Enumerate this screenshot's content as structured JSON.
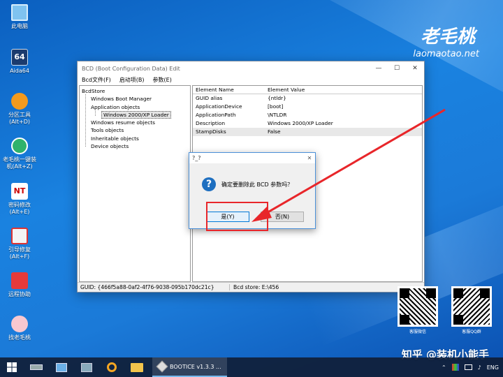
{
  "desktop": {
    "icons": [
      {
        "label": "此电脑",
        "icon": "computer-icon"
      },
      {
        "label": "Aida64",
        "icon": "aida64-icon",
        "badge": "64"
      },
      {
        "label": "分区工具\n(Alt+D)",
        "icon": "partition-tool-icon"
      },
      {
        "label": "老毛桃一键装\n机(Alt+Z)",
        "icon": "installer-icon"
      },
      {
        "label": "密码修改\n(Alt+E)",
        "icon": "password-tool-icon",
        "badge": "NT"
      },
      {
        "label": "引导修复\n(Alt+F)",
        "icon": "boot-repair-icon"
      },
      {
        "label": "远程协助",
        "icon": "remote-assist-icon"
      },
      {
        "label": "找老毛桃",
        "icon": "laomaotao-icon"
      }
    ]
  },
  "brand": {
    "logo": "老毛桃",
    "url": "laomaotao.net"
  },
  "window": {
    "title": "BCD (Boot Configuration Data) Edit",
    "menu": [
      "Bcd文件(F)",
      "启动项(B)",
      "参数(E)"
    ],
    "tree": [
      {
        "label": "BcdStore",
        "level": 0
      },
      {
        "label": "Windows Boot Manager",
        "level": 1
      },
      {
        "label": "Application objects",
        "level": 1
      },
      {
        "label": "Windows 2000/XP Loader",
        "level": 2
      },
      {
        "label": "Windows resume objects",
        "level": 1
      },
      {
        "label": "Tools objects",
        "level": 1
      },
      {
        "label": "Inheritable objects",
        "level": 1
      },
      {
        "label": "Device objects",
        "level": 1
      }
    ],
    "columns": [
      "Element Name",
      "Element Value"
    ],
    "rows": [
      [
        "GUID alias",
        "{ntldr}"
      ],
      [
        "ApplicationDevice",
        "[boot]"
      ],
      [
        "ApplicationPath",
        "\\NTLDR"
      ],
      [
        "Description",
        "Windows 2000/XP Loader"
      ],
      [
        "StampDisks",
        "False"
      ]
    ],
    "status": {
      "guid": "GUID:  {466f5a88-0af2-4f76-9038-095b170dc21c}",
      "store": "Bcd store:   E:\\456"
    }
  },
  "dialog": {
    "title": "?_?",
    "message": "确定要删除此 BCD 参数吗？",
    "yes_label": "是(Y)",
    "no_label": "否(N)"
  },
  "qr": [
    {
      "caption": "客服微信"
    },
    {
      "caption": "客服QQ群"
    }
  ],
  "watermark": "知乎 @装机小能手",
  "taskbar": {
    "app_label": "BOOTICE v1.3.3 ...",
    "lang": "ENG"
  },
  "colors": {
    "annotation_red": "#e8262a",
    "dialog_accent": "#1e6fc0"
  }
}
